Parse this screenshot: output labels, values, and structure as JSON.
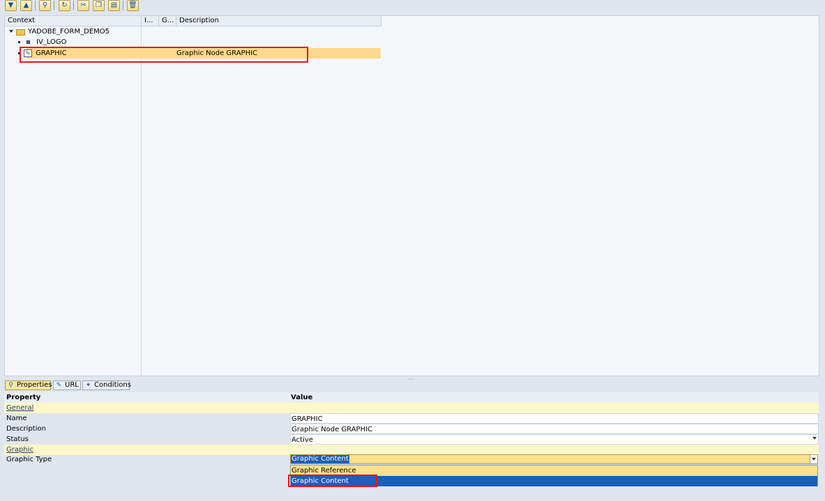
{
  "toolbar": {
    "icons": [
      "expand-icon",
      "collapse-icon",
      "find-icon",
      "refresh-icon",
      "cut-icon",
      "copy-icon",
      "paste-icon",
      "delete-icon"
    ]
  },
  "tree": {
    "columns": {
      "context": "Context",
      "col_i": "I...",
      "col_g": "G...",
      "description": "Description"
    },
    "root": "YADOBE_FORM_DEMO5",
    "items": [
      {
        "name": "IV_LOGO",
        "description": ""
      },
      {
        "name": "GRAPHIC",
        "description": "Graphic Node GRAPHIC"
      }
    ]
  },
  "tabs": {
    "properties": "Properties",
    "url": "URL",
    "conditions": "Conditions"
  },
  "properties": {
    "header_property": "Property",
    "header_value": "Value",
    "group_general": "General",
    "name_label": "Name",
    "name_value": "GRAPHIC",
    "description_label": "Description",
    "description_value": "Graphic Node GRAPHIC",
    "status_label": "Status",
    "status_value": "Active",
    "group_graphic": "Graphic",
    "graphic_type_label": "Graphic Type",
    "graphic_type_value": "Graphic Content",
    "graphic_type_options": [
      "Graphic Reference",
      "Graphic Content"
    ]
  },
  "colors": {
    "selection": "#ffd98e",
    "highlight_box": "#e8161c",
    "dropdown_selected": "#1b5fb6"
  }
}
